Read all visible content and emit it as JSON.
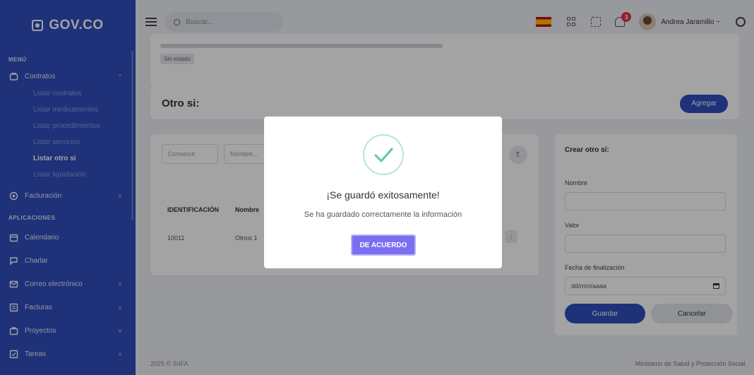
{
  "brand": {
    "name": "GOV.CO"
  },
  "sidebar": {
    "menu_title": "MENÚ",
    "contratos": {
      "label": "Contratos",
      "items": [
        "Listar contratos",
        "Listar medicamentos",
        "Listar procedimientos",
        "Listar servicios",
        "Listar otro si",
        "Listar liquidación"
      ]
    },
    "facturacion": {
      "label": "Facturación"
    },
    "apps_title": "APLICACIONES",
    "apps": [
      {
        "label": "Calendario",
        "icon": "calendar-icon"
      },
      {
        "label": "Charlar",
        "icon": "chat-icon"
      },
      {
        "label": "Correo electrónico",
        "icon": "mail-icon"
      },
      {
        "label": "Facturas",
        "icon": "invoice-icon"
      },
      {
        "label": "Proyectos",
        "icon": "projects-icon"
      },
      {
        "label": "Tareas",
        "icon": "tasks-icon"
      }
    ]
  },
  "topbar": {
    "search_placeholder": "Buscar...",
    "notification_count": "3",
    "user_name": "Andrea Jaramillo ~"
  },
  "status": {
    "chip": "Sin estado"
  },
  "otrosi": {
    "title": "Otro si:",
    "add_label": "Agregar"
  },
  "list": {
    "filters": {
      "consecutive": "Consecut",
      "name": "Nombre..."
    },
    "headers": {
      "id": "IDENTIFICACIÓN",
      "name": "Nombre"
    },
    "rows": [
      {
        "id": "10011",
        "name": "Otrosi 1"
      }
    ]
  },
  "form": {
    "title": "Crear otro sí:",
    "name_label": "Nombre",
    "value_label": "Valor",
    "date_label": "Fecha de finalización",
    "date_placeholder": "dd/mm/aaaa",
    "save_label": "Guardar",
    "cancel_label": "Cancelar"
  },
  "footer": {
    "left": "2025 © SIIFA",
    "right": "Ministerio de Salud y Protección Social."
  },
  "modal": {
    "title": "¡Se guardó exitosamente!",
    "message": "Se ha guardado correctamente la información",
    "ok_label": "DE ACUERDO"
  },
  "colors": {
    "primary": "#2f4dbd",
    "confirm": "#7c6ef0",
    "success": "#5cc9a0",
    "badge": "#e3344b"
  }
}
